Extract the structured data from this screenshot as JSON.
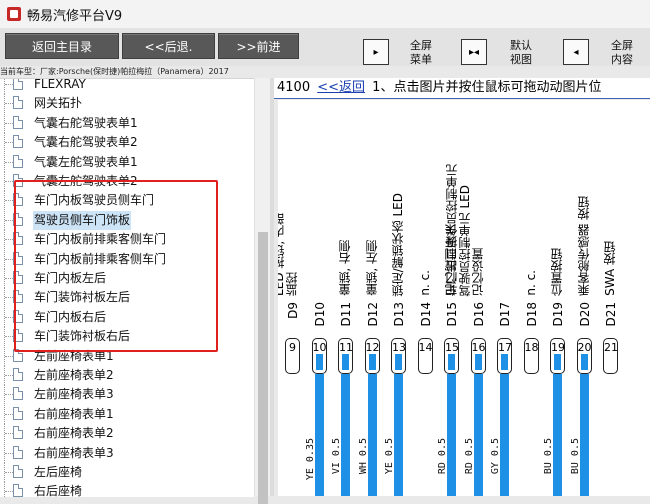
{
  "window": {
    "title": "畅易汽修平台V9"
  },
  "toolbar": {
    "main_menu": "返回主目录",
    "back": "<<后退.",
    "forward": ">>前进",
    "fullscreen_menu": "全屏\n菜单",
    "default_view": "默认\n视图",
    "fullscreen_content": "全屏\n内容"
  },
  "car_info": "当前车型：厂家:Porsche(保时捷)帕拉梅拉（Panamera）2017",
  "tree": {
    "items": [
      {
        "label": "FLEXRAY",
        "selected": false
      },
      {
        "label": "网关拓扑",
        "selected": false
      },
      {
        "label": "气囊右舵驾驶表单1",
        "selected": false
      },
      {
        "label": "气囊右舵驾驶表单2",
        "selected": false
      },
      {
        "label": "气囊左舵驾驶表单1",
        "selected": false
      },
      {
        "label": "气囊左舵驾驶表单2",
        "selected": false
      },
      {
        "label": "车门内板驾驶员侧车门",
        "selected": false
      },
      {
        "label": "驾驶员侧车门饰板",
        "selected": true
      },
      {
        "label": "车门内板前排乘客侧车门",
        "selected": false
      },
      {
        "label": "车门内板前排乘客侧车门",
        "selected": false
      },
      {
        "label": "车门内板左后",
        "selected": false
      },
      {
        "label": "车门装饰衬板左后",
        "selected": false
      },
      {
        "label": "车门内板右后",
        "selected": false
      },
      {
        "label": "车门装饰衬板右后",
        "selected": false
      },
      {
        "label": "左前座椅表单1",
        "selected": false
      },
      {
        "label": "左前座椅表单2",
        "selected": false
      },
      {
        "label": "左前座椅表单3",
        "selected": false
      },
      {
        "label": "右前座椅表单1",
        "selected": false
      },
      {
        "label": "右前座椅表单2",
        "selected": false
      },
      {
        "label": "右前座椅表单3",
        "selected": false
      },
      {
        "label": "左后座椅",
        "selected": false
      },
      {
        "label": "右后座椅",
        "selected": false
      }
    ]
  },
  "content": {
    "code": "4100",
    "back_link": "<<返回",
    "instruction": "1、点击图片并按住鼠标可拖动动图片位"
  },
  "diagram": {
    "pins": [
      {
        "label": "D9",
        "num": "9",
        "texts": [
          "LCA 状态",
          "LED 按钮, 内部",
          "监控"
        ],
        "wire": "",
        "wired": false
      },
      {
        "label": "D10",
        "num": "10",
        "texts": [],
        "wire": "YE 0.35",
        "wired": true
      },
      {
        "label": "D11",
        "num": "11",
        "texts": [
          "童锁, 右侧"
        ],
        "wire": "VI 0.5",
        "wired": true
      },
      {
        "label": "D12",
        "num": "12",
        "texts": [
          "童锁, 左侧"
        ],
        "wire": "WH 0.5",
        "wired": true
      },
      {
        "label": "D13",
        "num": "13",
        "texts": [
          "锁定/解锁状态 LED"
        ],
        "wire": "YE 0.5",
        "wired": true
      },
      {
        "label": "D14",
        "num": "14",
        "texts": [
          "n. c."
        ],
        "wire": "",
        "wired": false
      },
      {
        "label": "D15",
        "num": "15",
        "texts": [
          "记忆控制开关"
        ],
        "wire": "RD 0.5",
        "wired": true
      },
      {
        "label": "D16",
        "num": "16",
        "texts": [
          "车门出口操作员控制单元",
          "驾驶员控制单元 LED",
          "记忆设置"
        ],
        "wire": "RD 0.5",
        "wired": true
      },
      {
        "label": "D17",
        "num": "17",
        "texts": [],
        "wire": "GY 0.5",
        "wired": true
      },
      {
        "label": "D18",
        "num": "18",
        "texts": [
          "n. c."
        ],
        "wire": "",
        "wired": false
      },
      {
        "label": "D19",
        "num": "19",
        "texts": [
          "位置按钮"
        ],
        "wire": "BU 0.5",
        "wired": true
      },
      {
        "label": "D20",
        "num": "20",
        "texts": [
          "乘客舱传感器 按钮"
        ],
        "wire": "BU 0.5",
        "wired": true
      },
      {
        "label": "D21",
        "num": "21",
        "texts": [
          "SWA 按钮"
        ],
        "wire": "",
        "wired": false
      }
    ]
  },
  "colors": {
    "wire": "#1e90e6",
    "highlight": "#e0201e",
    "selected": "#cde4f7",
    "button": "#585858"
  }
}
